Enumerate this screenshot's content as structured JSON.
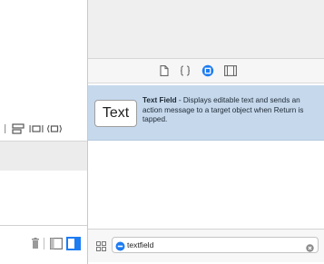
{
  "library": {
    "item": {
      "thumbnail_text": "Text",
      "title": "Text Field",
      "description": " - Displays editable text and sends an action message to a target object when Return is tapped."
    }
  },
  "filter": {
    "value": "textfield",
    "placeholder": "Filter"
  },
  "icons": {
    "library_tabs": [
      "file-icon",
      "braces-icon",
      "object-library-icon",
      "media-icon"
    ],
    "left_toolbar": [
      "align-icon",
      "pin-icon",
      "resolve-icon"
    ],
    "left_bottom": [
      "trash-icon",
      "split-view-icon",
      "toggle-panel-icon"
    ]
  },
  "colors": {
    "accent": "#1d7cf2",
    "selected_row": "#c6d8ec"
  }
}
